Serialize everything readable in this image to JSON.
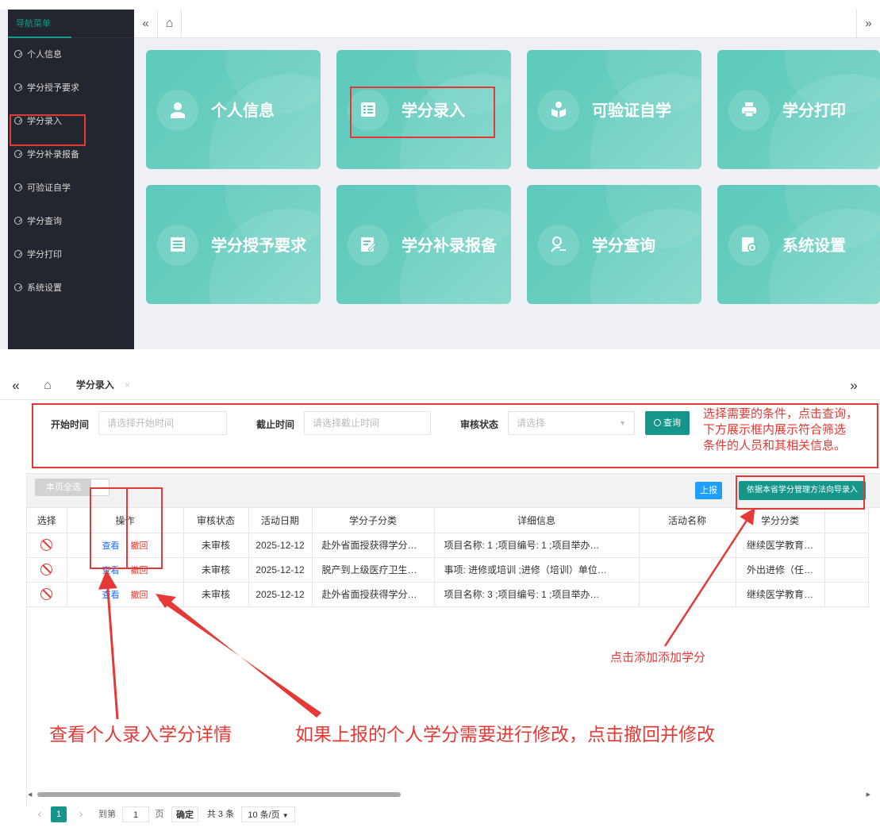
{
  "top": {
    "sidebar": {
      "title": "导航菜单",
      "items": [
        {
          "label": "个人信息"
        },
        {
          "label": "学分授予要求"
        },
        {
          "label": "学分录入"
        },
        {
          "label": "学分补录报备"
        },
        {
          "label": "可验证自学"
        },
        {
          "label": "学分查询"
        },
        {
          "label": "学分打印"
        },
        {
          "label": "系统设置"
        }
      ]
    },
    "tabbar": {
      "prev": "«",
      "home": "⌂",
      "next": "»"
    },
    "tiles": [
      {
        "label": "个人信息",
        "icon": "user-icon"
      },
      {
        "label": "学分录入",
        "icon": "list-icon"
      },
      {
        "label": "可验证自学",
        "icon": "study-icon"
      },
      {
        "label": "学分打印",
        "icon": "printer-icon"
      },
      {
        "label": "学分授予要求",
        "icon": "checklist-icon"
      },
      {
        "label": "学分补录报备",
        "icon": "edit-icon"
      },
      {
        "label": "学分查询",
        "icon": "search-user-icon"
      },
      {
        "label": "系统设置",
        "icon": "settings-icon"
      }
    ]
  },
  "bottom": {
    "tabbar": {
      "prev": "«",
      "home": "⌂",
      "active_tab": "学分录入",
      "close": "×",
      "next": "»"
    },
    "filters": {
      "start_label": "开始时间",
      "start_placeholder": "请选择开始时间",
      "end_label": "截止时间",
      "end_placeholder": "请选择截止时间",
      "status_label": "审核状态",
      "status_placeholder": "请选择",
      "query_button": "查询"
    },
    "filter_note": [
      "选择需要的条件，点击查询，",
      "下方展示框内展示符合筛选",
      "条件的人员和其相关信息。"
    ],
    "toolbar": {
      "select_all": "本页全选",
      "report_button": "上报",
      "import_button": "依据本省学分管理方法向导录入"
    },
    "table": {
      "columns": [
        "选择",
        "操作",
        "审核状态",
        "活动日期",
        "学分子分类",
        "详细信息",
        "活动名称",
        "学分分类"
      ],
      "view_label": "查看",
      "revoke_label": "撤回",
      "rows": [
        {
          "status": "未审核",
          "date": "2025-12-12",
          "sub": "赴外省面授获得学分…",
          "detail": "项目名称: 1 ;项目编号: 1 ;项目举办…",
          "activity": "",
          "category": "继续医学教育…"
        },
        {
          "status": "未审核",
          "date": "2025-12-12",
          "sub": "脱产到上级医疗卫生…",
          "detail": "事项: 进修或培训 ;进修（培训）单位…",
          "activity": "",
          "category": "外出进修（任…"
        },
        {
          "status": "未审核",
          "date": "2025-12-12",
          "sub": "赴外省面授获得学分…",
          "detail": "项目名称: 3 ;项目编号: 1 ;项目举办…",
          "activity": "",
          "category": "继续医学教育…"
        }
      ]
    },
    "annotations": {
      "add_credit": "点击添加添加学分",
      "view_detail": "查看个人录入学分详情",
      "revoke_modify": "如果上报的个人学分需要进行修改，点击撤回并修改"
    },
    "pager": {
      "prev": "‹",
      "current_page": "1",
      "next": "›",
      "goto_label": "到第",
      "goto_value": "1",
      "page_unit": "页",
      "confirm": "确定",
      "total": "共 3 条",
      "page_size": "10 条/页"
    },
    "colors": {
      "accent": "#16968a",
      "annotation": "#e53935",
      "link": "#1e6fff",
      "report": "#1e9fff"
    }
  }
}
